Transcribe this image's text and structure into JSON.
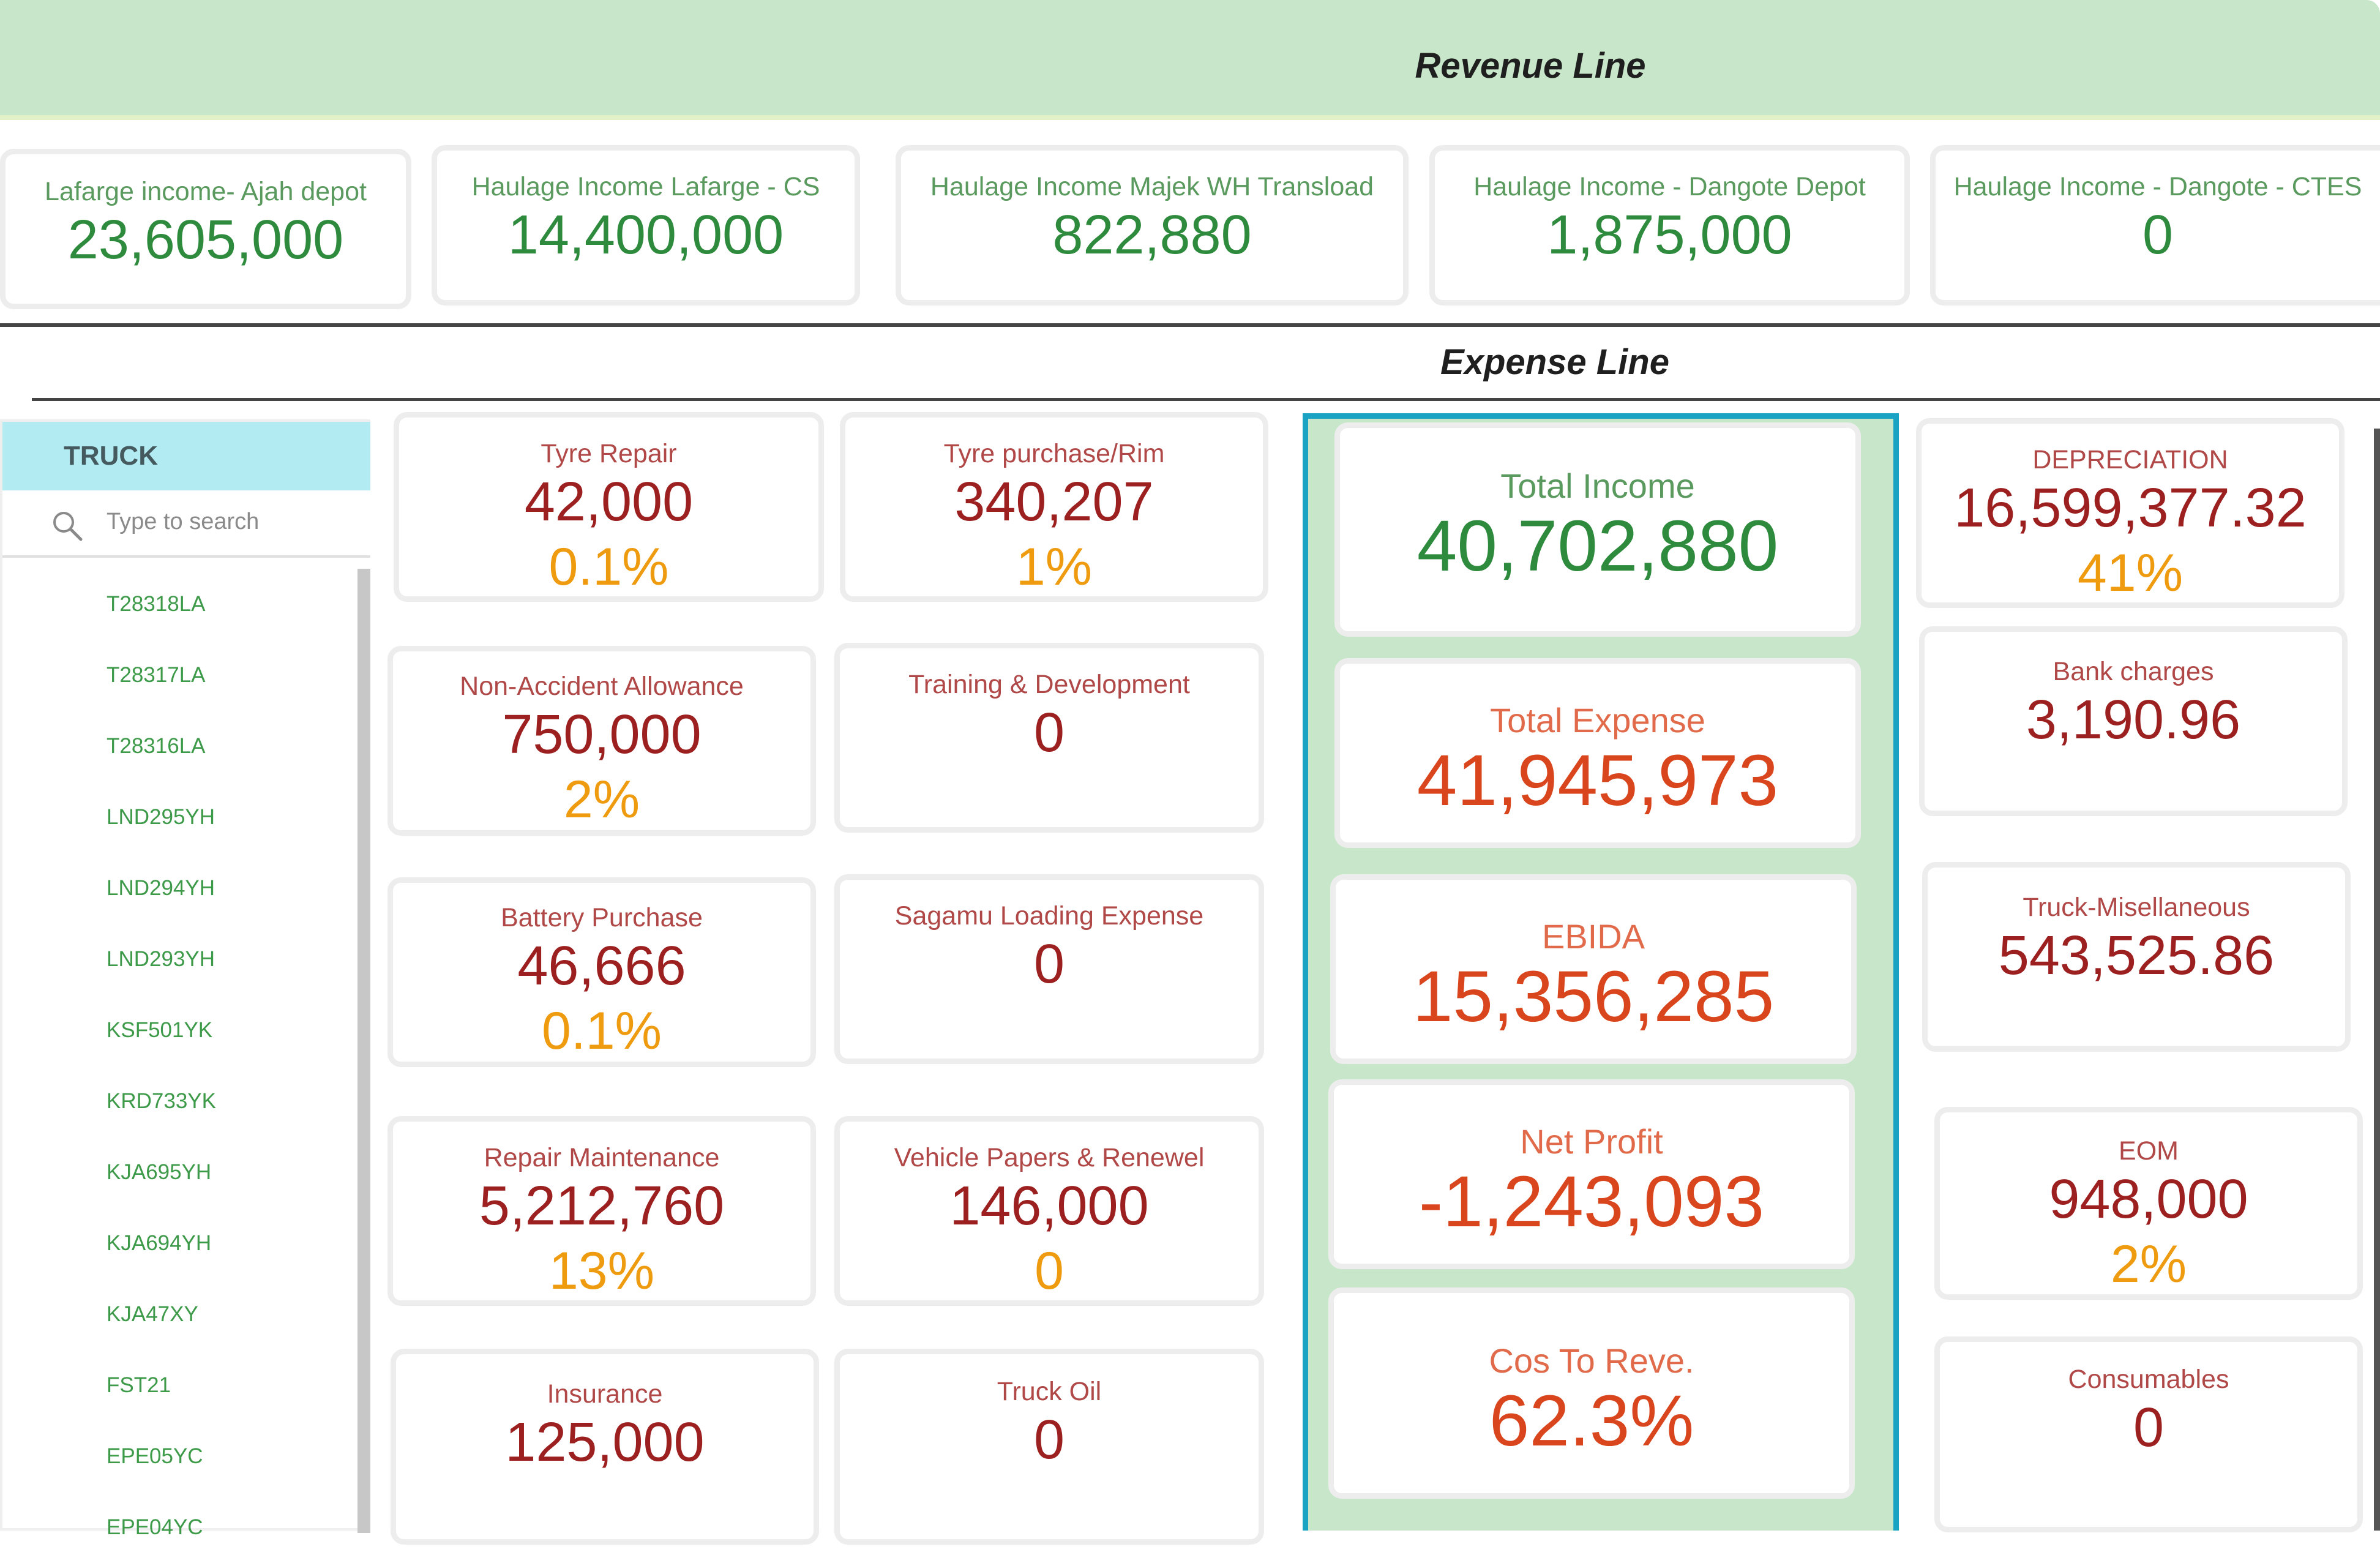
{
  "revenue": {
    "title": "Revenue Line",
    "cards": [
      {
        "label": "Lafarge income- Ajah depot",
        "value": "23,605,000"
      },
      {
        "label": "Haulage Income Lafarge - CS",
        "value": "14,400,000"
      },
      {
        "label": "Haulage Income Majek WH Transload",
        "value": "822,880"
      },
      {
        "label": "Haulage Income - Dangote Depot",
        "value": "1,875,000"
      },
      {
        "label": "Haulage Income - Dangote - CTES",
        "value": "0"
      }
    ]
  },
  "expense": {
    "title": "Expense Line",
    "left_cards": [
      {
        "label": "Tyre Repair",
        "value": "42,000",
        "pct": "0.1%"
      },
      {
        "label": "Non-Accident Allowance",
        "value": "750,000",
        "pct": "2%"
      },
      {
        "label": "Battery Purchase",
        "value": "46,666",
        "pct": "0.1%"
      },
      {
        "label": "Repair Maintenance",
        "value": "5,212,760",
        "pct": "13%"
      },
      {
        "label": "Insurance",
        "value": "125,000",
        "pct": ""
      }
    ],
    "mid_cards": [
      {
        "label": "Tyre purchase/Rim",
        "value": "340,207",
        "pct": "1%"
      },
      {
        "label": "Training & Development",
        "value": "0",
        "pct": ""
      },
      {
        "label": "Sagamu Loading Expense",
        "value": "0",
        "pct": ""
      },
      {
        "label": "Vehicle Papers & Renewel",
        "value": "146,000",
        "pct": "0"
      },
      {
        "label": "Truck Oil",
        "value": "0",
        "pct": ""
      }
    ],
    "right_cards": [
      {
        "label": "DEPRECIATION",
        "value": "16,599,377.32",
        "pct": "41%"
      },
      {
        "label": "Bank charges",
        "value": "3,190.96",
        "pct": ""
      },
      {
        "label": "Truck-Misellaneous",
        "value": "543,525.86",
        "pct": ""
      },
      {
        "label": "EOM",
        "value": "948,000",
        "pct": "2%"
      },
      {
        "label": "Consumables",
        "value": "0",
        "pct": ""
      }
    ]
  },
  "kpis": [
    {
      "label": "Total Income",
      "value": "40,702,880",
      "color": "#2e8b3d",
      "label_color": "#5a9a5e"
    },
    {
      "label": "Total Expense",
      "value": "41,945,973",
      "color": "#d9461e",
      "label_color": "#e06a4a"
    },
    {
      "label": "EBIDA",
      "value": "15,356,285",
      "color": "#d9461e",
      "label_color": "#e06a4a"
    },
    {
      "label": "Net Profit",
      "value": "-1,243,093",
      "color": "#d9461e",
      "label_color": "#e06a4a"
    },
    {
      "label": "Cos To Reve.",
      "value": "62.3%",
      "color": "#d9461e",
      "label_color": "#e06a4a"
    }
  ],
  "slicer": {
    "header": "TRUCK",
    "search_placeholder": "Type to search",
    "items": [
      "T28318LA",
      "T28317LA",
      "T28316LA",
      "LND295YH",
      "LND294YH",
      "LND293YH",
      "KSF501YK",
      "KRD733YK",
      "KJA695YH",
      "KJA694YH",
      "KJA47XY",
      "FST21",
      "EPE05YC",
      "EPE04YC"
    ]
  },
  "colors": {
    "banner_bg": "#c8e6c9",
    "slicer_header_bg": "#b2ebf2",
    "kpi_panel_border": "#1aa3c2",
    "percent": "#ef9b0f"
  }
}
